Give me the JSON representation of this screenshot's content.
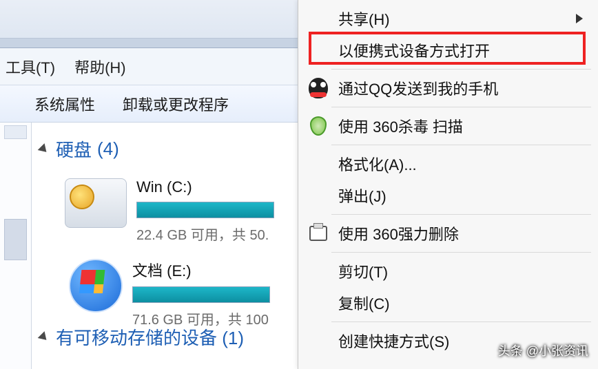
{
  "menubar": {
    "tools": "工具(T)",
    "help": "帮助(H)"
  },
  "toolbar": {
    "sys_props": "系统属性",
    "uninstall": "卸载或更改程序"
  },
  "sections": {
    "drives_label": "硬盘",
    "drives_count": "(4)",
    "removable_label": "有可移动存储的设备 (1)"
  },
  "drives": [
    {
      "name": "Win (C:)",
      "fill_pct": 100,
      "usage": "22.4 GB 可用，共 50."
    },
    {
      "name": "文档 (E:)",
      "fill_pct": 100,
      "usage": "71.6 GB 可用，共 100"
    }
  ],
  "context_menu": {
    "share": "共享(H)",
    "open_portable": "以便携式设备方式打开",
    "qq_send": "通过QQ发送到我的手机",
    "scan_360": "使用 360杀毒 扫描",
    "format": "格式化(A)...",
    "eject": "弹出(J)",
    "force_delete": "使用 360强力删除",
    "cut": "剪切(T)",
    "copy": "复制(C)",
    "shortcut": "创建快捷方式(S)"
  },
  "watermark": "头条 @小张资讯"
}
